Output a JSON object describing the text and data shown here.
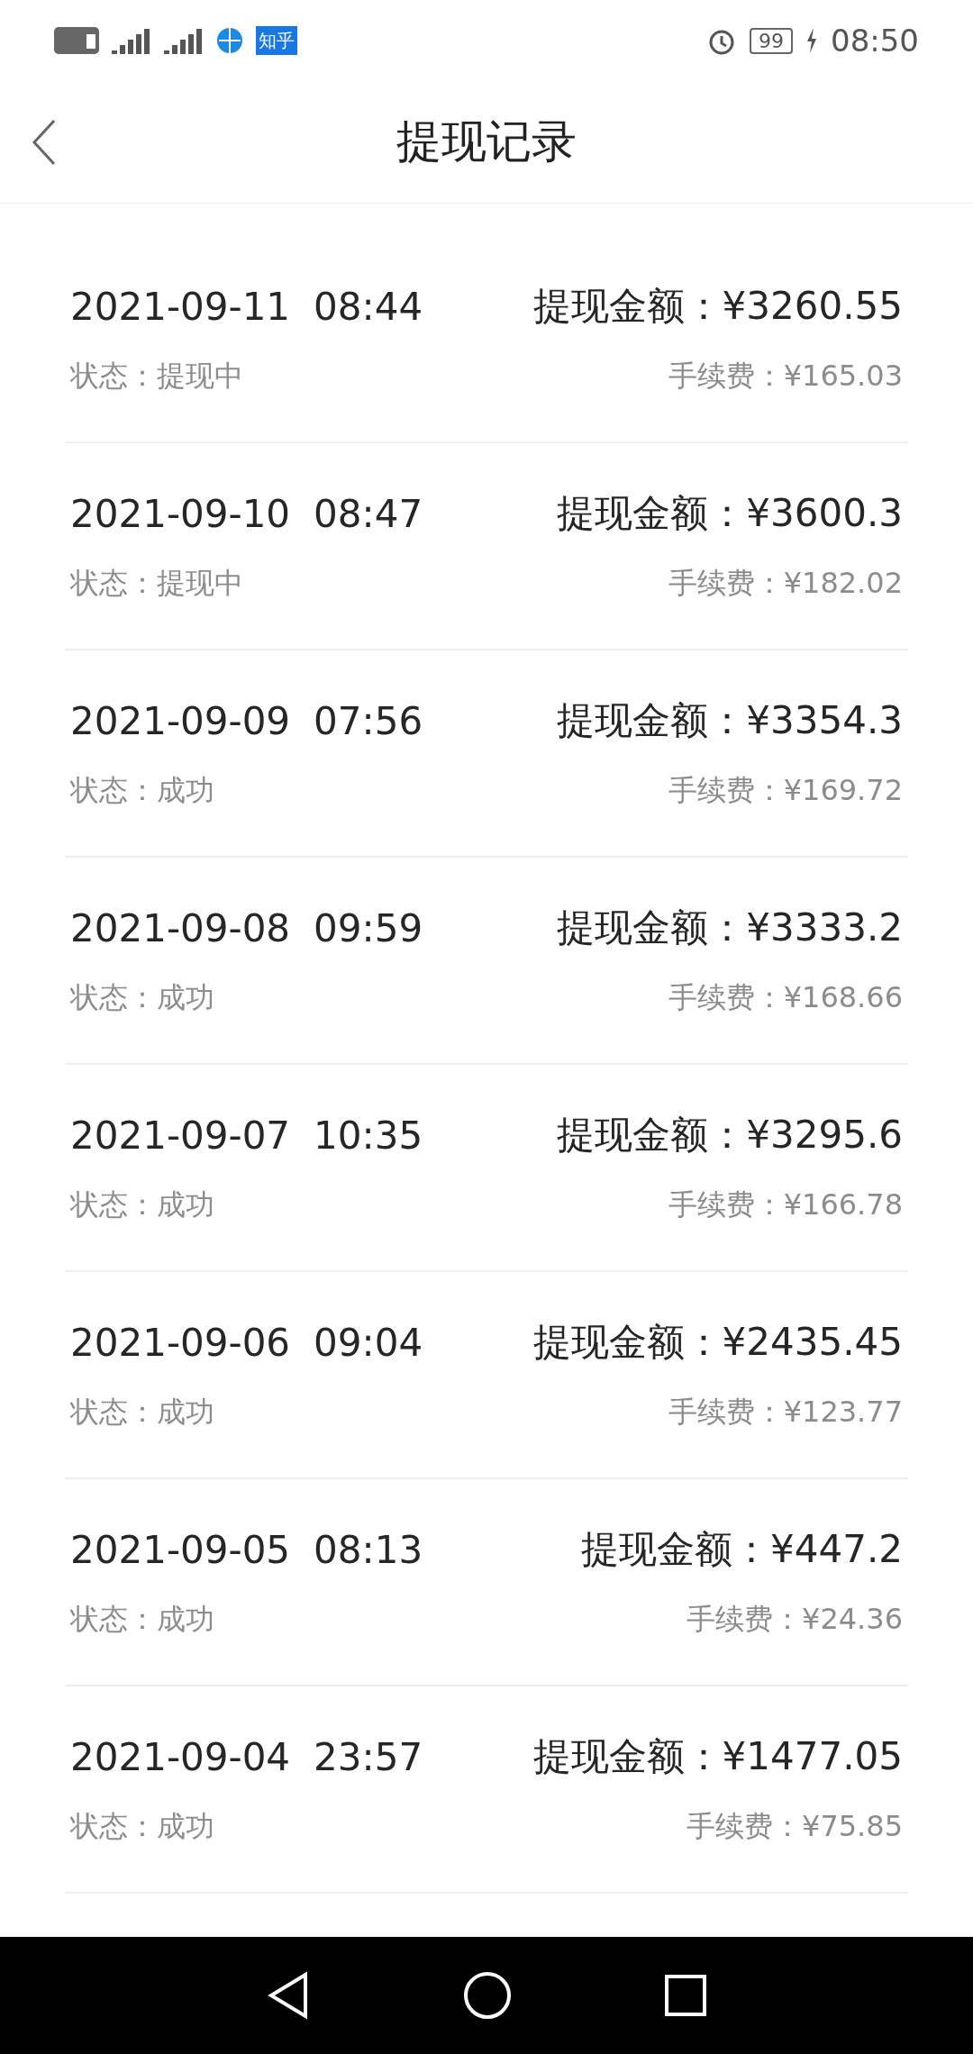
{
  "status_bar": {
    "apps": [
      "知乎"
    ],
    "battery": "99",
    "time": "08:50"
  },
  "header": {
    "title": "提现记录"
  },
  "records": [
    {
      "date": "2021-09-11",
      "time": "08:44",
      "amount": "提现金额：¥3260.55",
      "status": "状态：提现中",
      "fee": "手续费：¥165.03"
    },
    {
      "date": "2021-09-10",
      "time": "08:47",
      "amount": "提现金额：¥3600.3",
      "status": "状态：提现中",
      "fee": "手续费：¥182.02"
    },
    {
      "date": "2021-09-09",
      "time": "07:56",
      "amount": "提现金额：¥3354.3",
      "status": "状态：成功",
      "fee": "手续费：¥169.72"
    },
    {
      "date": "2021-09-08",
      "time": "09:59",
      "amount": "提现金额：¥3333.2",
      "status": "状态：成功",
      "fee": "手续费：¥168.66"
    },
    {
      "date": "2021-09-07",
      "time": "10:35",
      "amount": "提现金额：¥3295.6",
      "status": "状态：成功",
      "fee": "手续费：¥166.78"
    },
    {
      "date": "2021-09-06",
      "time": "09:04",
      "amount": "提现金额：¥2435.45",
      "status": "状态：成功",
      "fee": "手续费：¥123.77"
    },
    {
      "date": "2021-09-05",
      "time": "08:13",
      "amount": "提现金额：¥447.2",
      "status": "状态：成功",
      "fee": "手续费：¥24.36"
    },
    {
      "date": "2021-09-04",
      "time": "23:57",
      "amount": "提现金额：¥1477.05",
      "status": "状态：成功",
      "fee": "手续费：¥75.85"
    }
  ]
}
